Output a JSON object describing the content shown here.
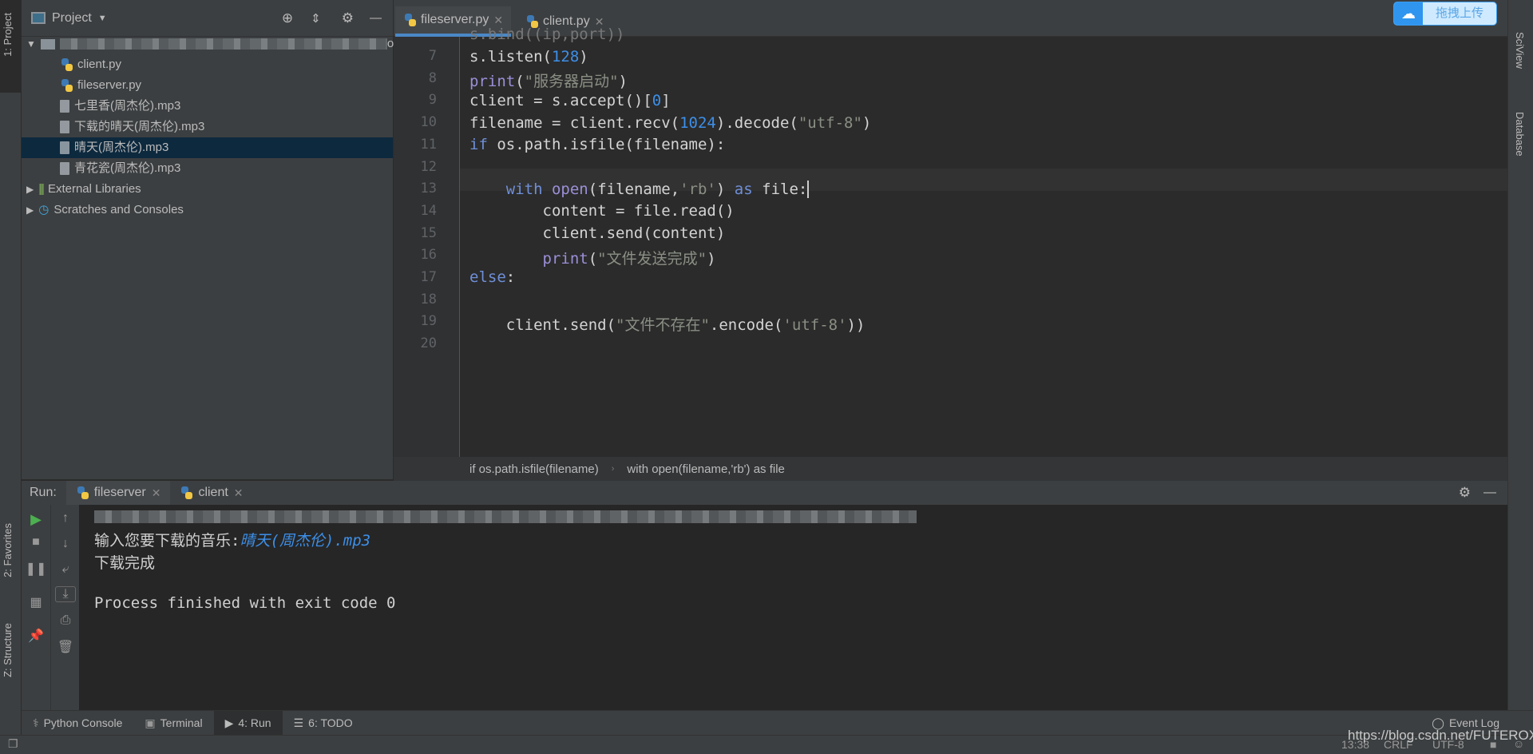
{
  "left_strip": {
    "project_tab": "1: Project",
    "favorites_tab": "2: Favorites",
    "structure_tab": "Z: Structure"
  },
  "project_panel": {
    "title": "Project",
    "tree": [
      {
        "label": "client.py",
        "type": "python"
      },
      {
        "label": "fileserver.py",
        "type": "python"
      },
      {
        "label": "七里香(周杰伦).mp3",
        "type": "file"
      },
      {
        "label": "下载的晴天(周杰伦).mp3",
        "type": "file"
      },
      {
        "label": "晴天(周杰伦).mp3",
        "type": "file",
        "selected": true
      },
      {
        "label": "青花瓷(周杰伦).mp3",
        "type": "file"
      }
    ],
    "root_suffix": "ow",
    "external_libraries": "External Libraries",
    "scratches": "Scratches and Consoles"
  },
  "editor": {
    "tabs": [
      {
        "label": "fileserver.py",
        "active": true
      },
      {
        "label": "client.py"
      }
    ],
    "line_numbers": [
      "7",
      "8",
      "9",
      "10",
      "11",
      "12",
      "13",
      "14",
      "15",
      "16",
      "17",
      "18",
      "19",
      "20"
    ],
    "breadcrumb": [
      "if os.path.isfile(filename)",
      "with open(filename,'rb') as file"
    ]
  },
  "run": {
    "label": "Run:",
    "tabs": [
      "fileserver",
      "client"
    ],
    "console": {
      "prompt": "输入您要下载的音乐:",
      "input": "晴天(周杰伦).mp3",
      "done": "下载完成",
      "exit": "Process finished with exit code 0"
    }
  },
  "bottom_tabs": [
    {
      "label": "Python Console"
    },
    {
      "label": "Terminal"
    },
    {
      "label": "4: Run",
      "active": true
    },
    {
      "label": "6: TODO"
    }
  ],
  "event_log": "Event Log",
  "status": {
    "position": "13:38",
    "line_sep": "CRLF",
    "encoding": "UTF-8"
  },
  "watermark": "https://blog.csdn.net/FUTEROX",
  "right_strip": {
    "sciview": "SciView",
    "database": "Database"
  },
  "upload_button": "拖拽上传",
  "colors": {
    "accent": "#4a88c7",
    "keyword": "#6f8fd8",
    "number": "#3d8fe8",
    "selection": "#0d293e"
  }
}
